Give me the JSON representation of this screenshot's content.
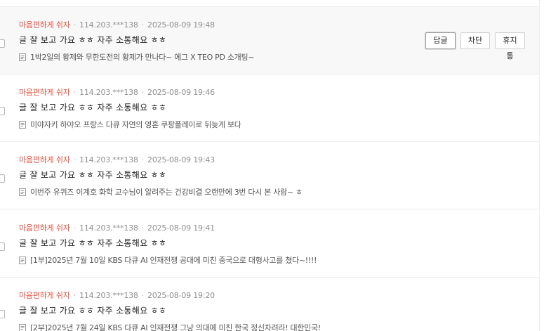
{
  "comments": [
    {
      "nickname": "마음편하게 쉬자",
      "ip": "114.203.***138",
      "datetime": "2025-08-09 19:48",
      "text": "글 잘 보고 가요 ㅎㅎ 자주 소통해요 ㅎㅎ",
      "post_title": "1박2일의 황제와 무한도전의 황제가 만나다~ 에그 X TEO PD 소개팅~"
    },
    {
      "nickname": "마음편하게 쉬자",
      "ip": "114.203.***138",
      "datetime": "2025-08-09 19:46",
      "text": "글 잘 보고 가요 ㅎㅎ 자주 소통해요 ㅎㅎ",
      "post_title": "미야자키 하야오 프랑스 다큐 자연의 영혼 쿠팡플레이로 뒤늦게 보다"
    },
    {
      "nickname": "마음편하게 쉬자",
      "ip": "114.203.***138",
      "datetime": "2025-08-09 19:43",
      "text": "글 잘 보고 가요 ㅎㅎ 자주 소통해요 ㅎㅎ",
      "post_title": "이번주 유퀴즈 이계호 화학 교수님이 알려주는 건강비결 오랜만에 3번 다시 본 사람~ ㅎ"
    },
    {
      "nickname": "마음편하게 쉬자",
      "ip": "114.203.***138",
      "datetime": "2025-08-09 19:41",
      "text": "글 잘 보고 가요 ㅎㅎ 자주 소통해요 ㅎㅎ",
      "post_title": "[1부]2025년 7월 10일 KBS 다큐 AI 인재전쟁 공대에 미친 중국으로 대형사고를 쳤다~!!!!"
    },
    {
      "nickname": "마음편하게 쉬자",
      "ip": "114.203.***138",
      "datetime": "2025-08-09 19:20",
      "text": "글 잘 보고 가요 ㅎㅎ 자주 소통해요 ㅎㅎ",
      "post_title": "[2부]2025년 7월 24일 KBS 다큐 AI 인재전쟁 그냥 의대에 미친 한국 정신차려라! 대한민국!"
    }
  ],
  "actions": {
    "reply_label": "답글",
    "block_label": "차단",
    "trash_label": "휴지통"
  },
  "colors": {
    "nickname": "#e8503f",
    "meta": "#8f8f8f",
    "hover_row_bg": "#f8f8f9"
  },
  "icons": {
    "post": "document-icon"
  }
}
